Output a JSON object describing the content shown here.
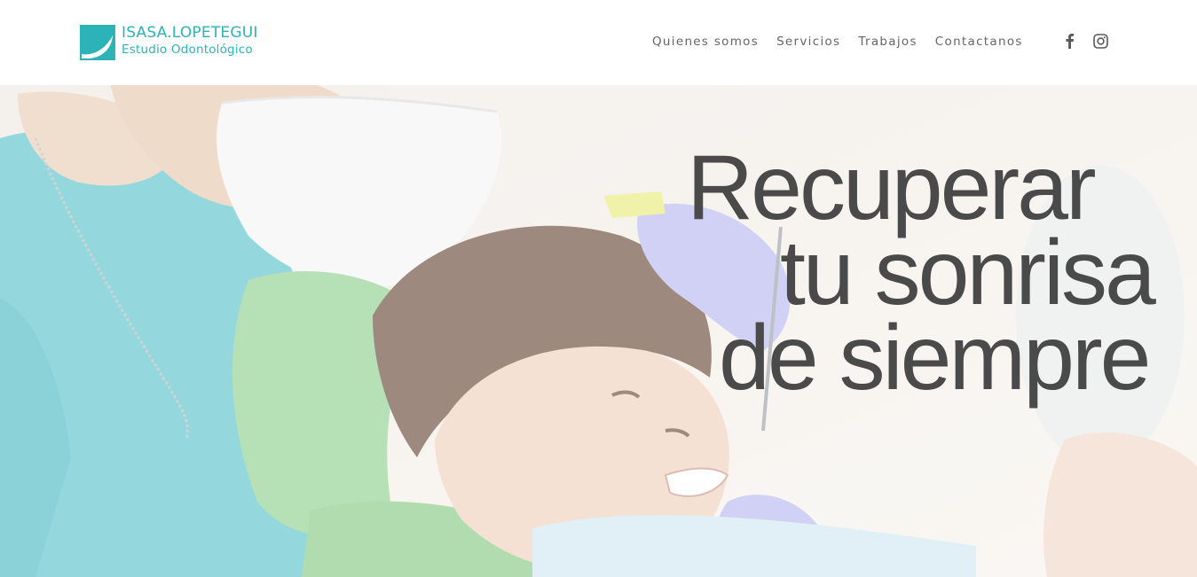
{
  "brand": {
    "name": "ISASA.LOPETEGUI",
    "subtitle": "Estudio Odontológico",
    "accent_color": "#2bb3b8"
  },
  "nav": {
    "items": [
      {
        "label": "Quienes somos"
      },
      {
        "label": "Servicios"
      },
      {
        "label": "Trabajos"
      },
      {
        "label": "Contactanos"
      }
    ]
  },
  "social": {
    "icons": [
      "facebook-icon",
      "instagram-icon"
    ]
  },
  "hero": {
    "lines": [
      "Recuperar",
      "tu sonrisa",
      "de siempre"
    ],
    "image": "dentist-with-child-patient"
  }
}
